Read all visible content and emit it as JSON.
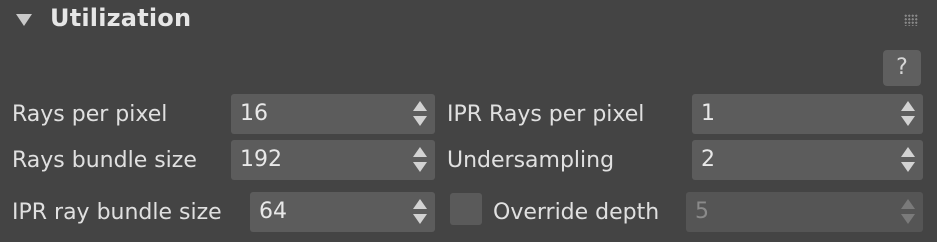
{
  "rollout": {
    "title": "Utilization",
    "help_label": "?"
  },
  "fields": {
    "rays_per_pixel": {
      "label": "Rays per pixel",
      "value": "16"
    },
    "rays_bundle_size": {
      "label": "Rays bundle size",
      "value": "192"
    },
    "ipr_ray_bundle_size": {
      "label": "IPR ray bundle size",
      "value": "64"
    },
    "ipr_rays_per_pixel": {
      "label": "IPR Rays per pixel",
      "value": "1"
    },
    "undersampling": {
      "label": "Undersampling",
      "value": "2"
    },
    "override_depth": {
      "label": "Override depth",
      "value": "5",
      "checked": false,
      "enabled": false
    }
  },
  "icons": {
    "collapse": "triangle-down-icon",
    "grip": "drag-grip-icon",
    "spinner_arrows": "up-down-arrows-icon"
  },
  "colors": {
    "panel_bg": "#444444",
    "field_bg": "#5c5c5c",
    "text": "#e0e0e0"
  }
}
